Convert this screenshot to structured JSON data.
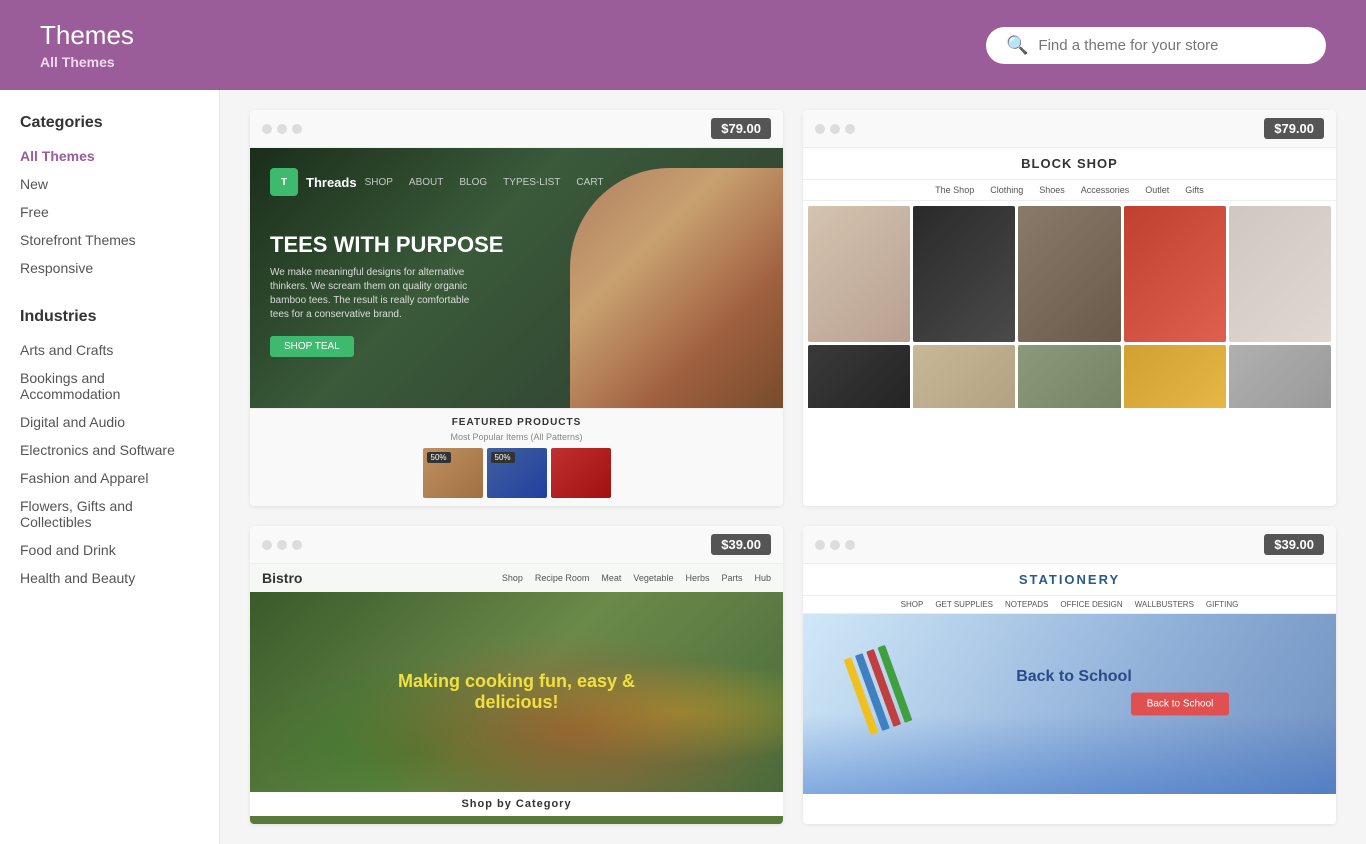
{
  "header": {
    "title": "Themes",
    "subtitle": "All Themes",
    "search_placeholder": "Find a theme for your store"
  },
  "sidebar": {
    "categories_label": "Categories",
    "categories": [
      {
        "label": "All Themes",
        "active": true
      },
      {
        "label": "New"
      },
      {
        "label": "Free"
      },
      {
        "label": "Storefront Themes"
      },
      {
        "label": "Responsive"
      }
    ],
    "industries_label": "Industries",
    "industries": [
      {
        "label": "Arts and Crafts"
      },
      {
        "label": "Bookings and Accommodation"
      },
      {
        "label": "Digital and Audio"
      },
      {
        "label": "Electronics and Software"
      },
      {
        "label": "Fashion and Apparel"
      },
      {
        "label": "Flowers, Gifts and Collectibles"
      },
      {
        "label": "Food and Drink"
      },
      {
        "label": "Health and Beauty"
      }
    ]
  },
  "themes": [
    {
      "name": "Threads",
      "price": "$79.00",
      "type": "threads"
    },
    {
      "name": "Block Shop",
      "price": "$79.00",
      "type": "blockshop"
    },
    {
      "name": "Bistro",
      "price": "$39.00",
      "type": "bistro"
    },
    {
      "name": "Stationery",
      "price": "$39.00",
      "type": "stationery"
    }
  ],
  "blockshop": {
    "title": "BLOCK SHOP",
    "nav_items": [
      "The Shop",
      "Clothing",
      "Shoes",
      "Accessories",
      "Outlet",
      "Gifts"
    ]
  },
  "bistro": {
    "logo": "Bistro",
    "nav_items": [
      "Shop",
      "Recipe Room",
      "Meat",
      "Vegetable",
      "Herbs",
      "Parts",
      "Hub"
    ],
    "hero_title": "Making cooking fun, easy & delicious!",
    "sub_label": "Shop by Category"
  },
  "stationery": {
    "title": "STATIONERY",
    "nav_items": [
      "Shop",
      "Get Supplies",
      "Notepads",
      "Office Design",
      "Wallbusters",
      "Gifting"
    ],
    "hero_title": "Back to School"
  },
  "threads": {
    "logo_text": "Threads",
    "hero_text": "TEES WITH PURPOSE",
    "sub_text": "We make meaningful designs for alternative thinkers. We scream them on quality organic bamboo tees. The result is really comfortable tees for a conservative brand.",
    "btn_label": "SHOP TEAL",
    "featured_label": "FEATURED PRODUCTS",
    "featured_sub": "Most Popular Items (All Patterns)"
  }
}
